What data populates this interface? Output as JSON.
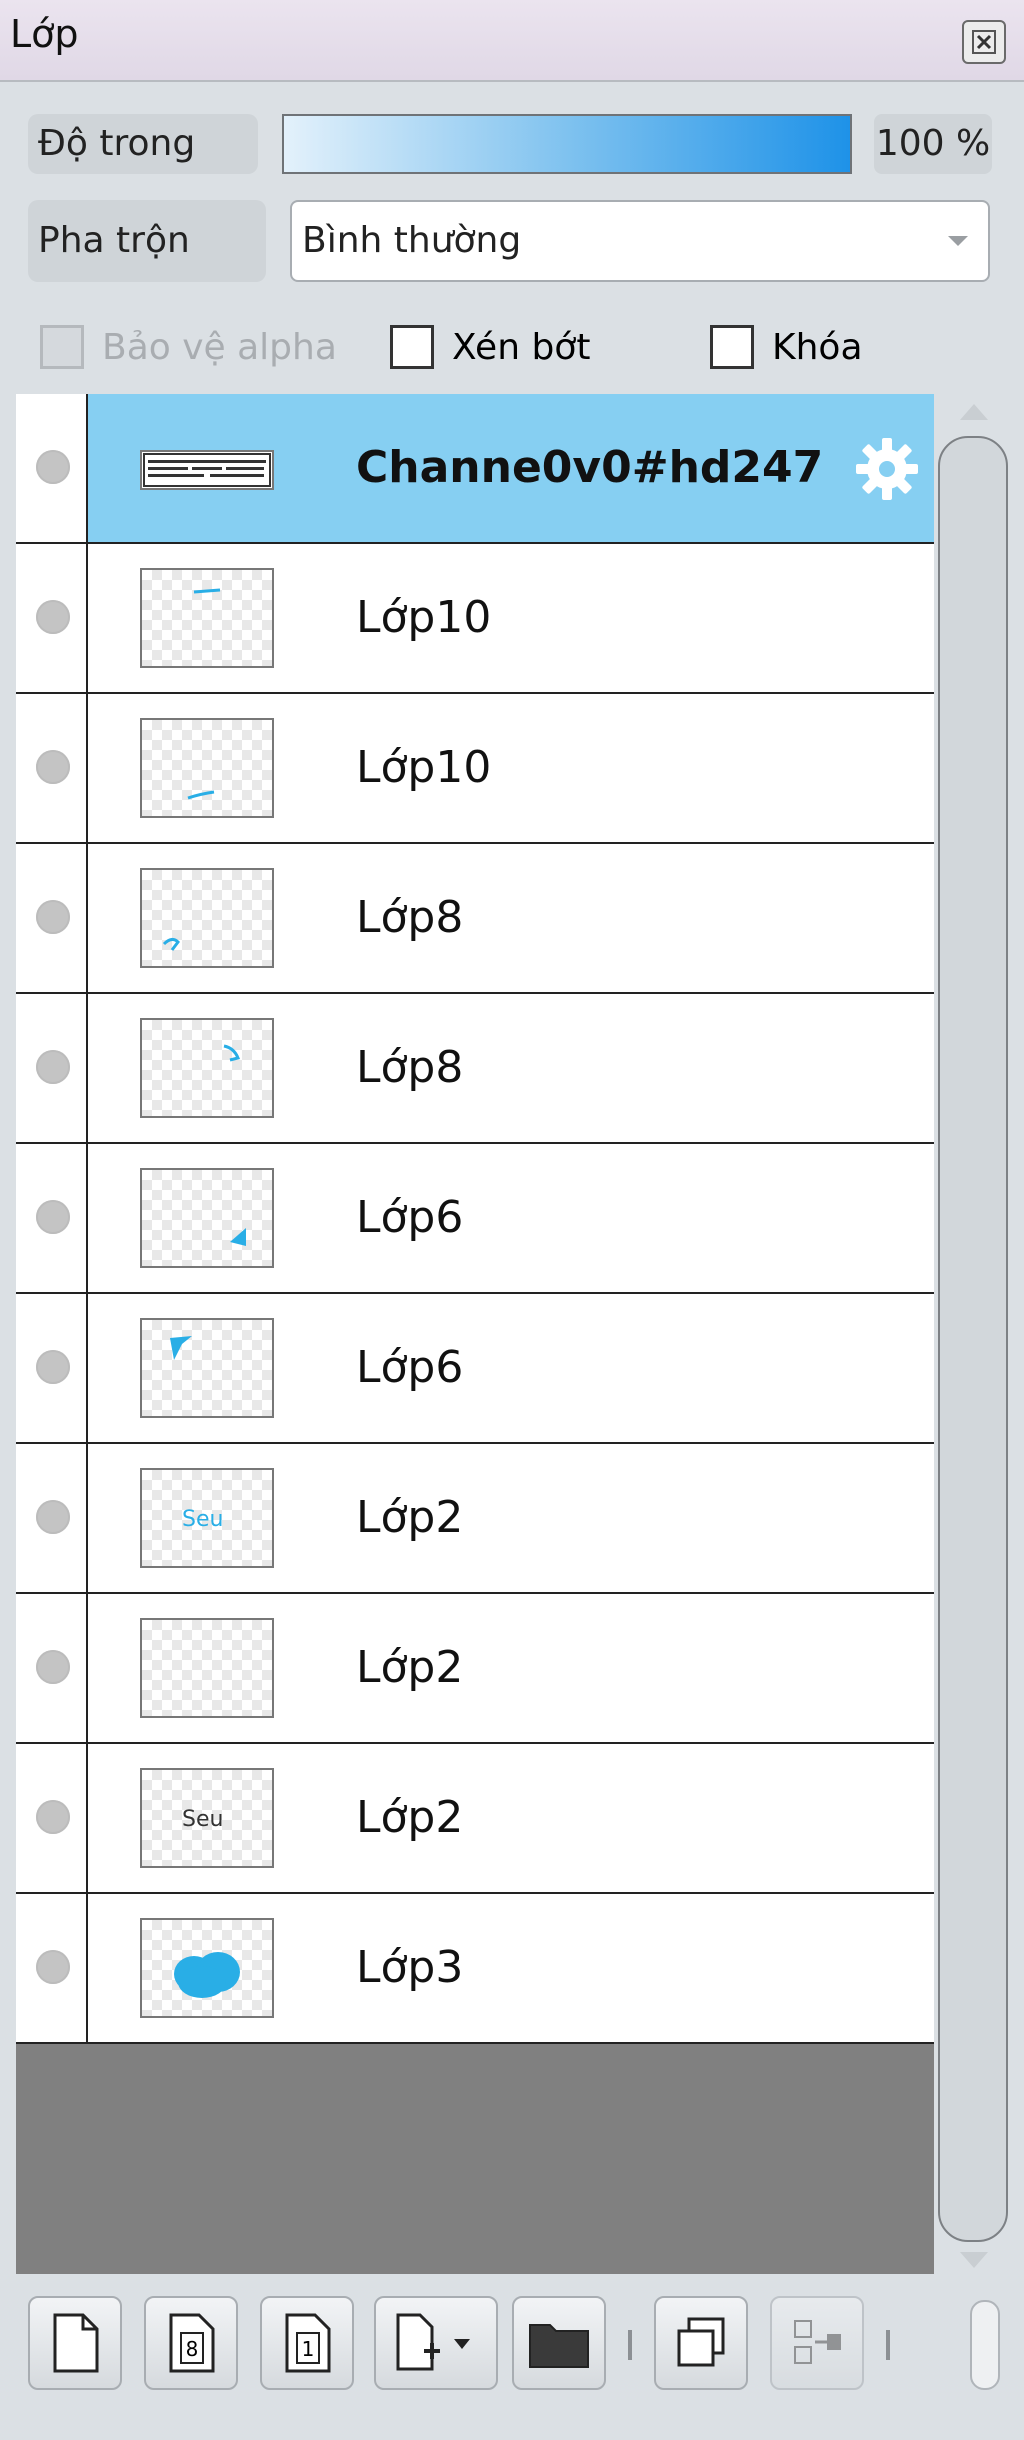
{
  "window": {
    "title": "Lớp"
  },
  "controls": {
    "opacity_label": "Độ trong",
    "opacity_value": 1.0,
    "opacity_text": "100 %",
    "blend_label": "Pha trộn",
    "blend_value": "Bình thường",
    "protect_alpha_label": "Bảo vệ alpha",
    "clipping_label": "Xén bớt",
    "lock_label": "Khóa"
  },
  "layers": [
    {
      "name": "Channe0v0#hd247",
      "active": true,
      "type": "text"
    },
    {
      "name": "Lớp10"
    },
    {
      "name": "Lớp10"
    },
    {
      "name": "Lớp8"
    },
    {
      "name": "Lớp8"
    },
    {
      "name": "Lớp6"
    },
    {
      "name": "Lớp6"
    },
    {
      "name": "Lớp2",
      "thumb_text": "Seu"
    },
    {
      "name": "Lớp2"
    },
    {
      "name": "Lớp2",
      "thumb_text": "Seu"
    },
    {
      "name": "Lớp3"
    }
  ],
  "toolbar": {
    "buttons": [
      "new-layer-icon",
      "new-8bit-layer-icon",
      "new-1bit-layer-icon",
      "add-layer-menu-icon",
      "new-folder-icon",
      "duplicate-layer-icon",
      "merge-down-icon"
    ]
  },
  "colors": {
    "selected_row": "#86cff2",
    "opacity_gradient_end": "#1e92e8",
    "paint_blue": "#29aee6"
  }
}
